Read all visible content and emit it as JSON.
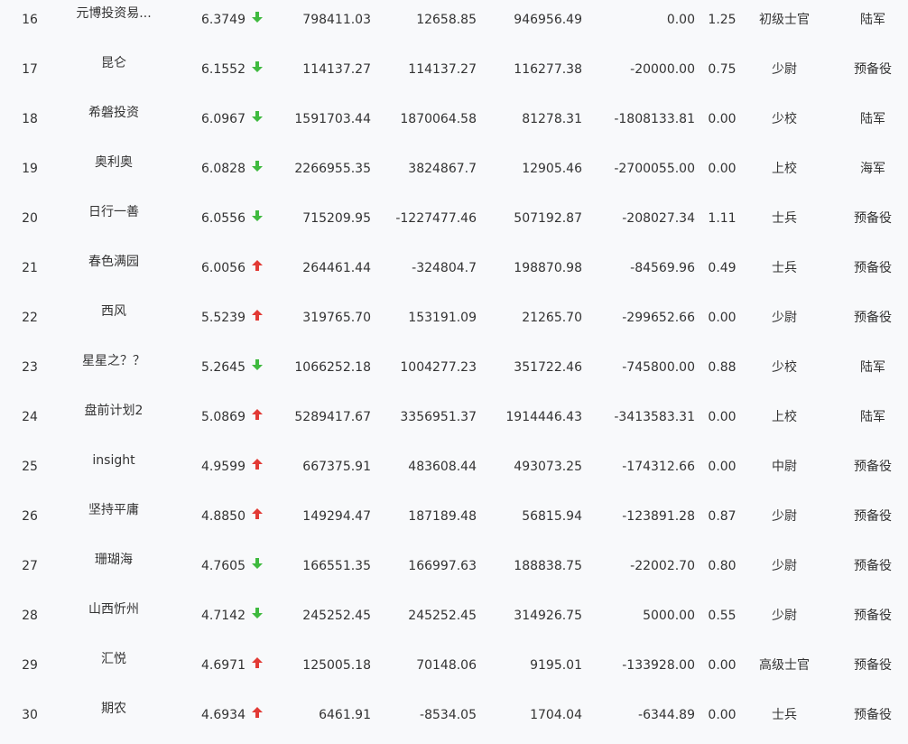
{
  "colors": {
    "up": "#e23a35",
    "down": "#3fba3f",
    "text": "#333333",
    "background": "#f8f9fb"
  },
  "rows": [
    {
      "rank": "16",
      "name": "元博投资易...",
      "nav": "6.3749",
      "trend": "down",
      "v1": "798411.03",
      "v2": "12658.85",
      "v3": "946956.49",
      "v4": "0.00",
      "ratio": "1.25",
      "level": "初级士官",
      "army": "陆军"
    },
    {
      "rank": "17",
      "name": "昆仑",
      "nav": "6.1552",
      "trend": "down",
      "v1": "114137.27",
      "v2": "114137.27",
      "v3": "116277.38",
      "v4": "-20000.00",
      "ratio": "0.75",
      "level": "少尉",
      "army": "预备役"
    },
    {
      "rank": "18",
      "name": "希磐投资",
      "nav": "6.0967",
      "trend": "down",
      "v1": "1591703.44",
      "v2": "1870064.58",
      "v3": "81278.31",
      "v4": "-1808133.81",
      "ratio": "0.00",
      "level": "少校",
      "army": "陆军"
    },
    {
      "rank": "19",
      "name": "奥利奥",
      "nav": "6.0828",
      "trend": "down",
      "v1": "2266955.35",
      "v2": "3824867.7",
      "v3": "12905.46",
      "v4": "-2700055.00",
      "ratio": "0.00",
      "level": "上校",
      "army": "海军"
    },
    {
      "rank": "20",
      "name": "日行一善",
      "nav": "6.0556",
      "trend": "down",
      "v1": "715209.95",
      "v2": "-1227477.46",
      "v3": "507192.87",
      "v4": "-208027.34",
      "ratio": "1.11",
      "level": "士兵",
      "army": "预备役"
    },
    {
      "rank": "21",
      "name": "春色满园",
      "nav": "6.0056",
      "trend": "up",
      "v1": "264461.44",
      "v2": "-324804.7",
      "v3": "198870.98",
      "v4": "-84569.96",
      "ratio": "0.49",
      "level": "士兵",
      "army": "预备役"
    },
    {
      "rank": "22",
      "name": "西风",
      "nav": "5.5239",
      "trend": "up",
      "v1": "319765.70",
      "v2": "153191.09",
      "v3": "21265.70",
      "v4": "-299652.66",
      "ratio": "0.00",
      "level": "少尉",
      "army": "预备役"
    },
    {
      "rank": "23",
      "name": "星星之？？",
      "nav": "5.2645",
      "trend": "down",
      "v1": "1066252.18",
      "v2": "1004277.23",
      "v3": "351722.46",
      "v4": "-745800.00",
      "ratio": "0.88",
      "level": "少校",
      "army": "陆军"
    },
    {
      "rank": "24",
      "name": "盘前计划2",
      "nav": "5.0869",
      "trend": "up",
      "v1": "5289417.67",
      "v2": "3356951.37",
      "v3": "1914446.43",
      "v4": "-3413583.31",
      "ratio": "0.00",
      "level": "上校",
      "army": "陆军"
    },
    {
      "rank": "25",
      "name": "insight",
      "nav": "4.9599",
      "trend": "up",
      "v1": "667375.91",
      "v2": "483608.44",
      "v3": "493073.25",
      "v4": "-174312.66",
      "ratio": "0.00",
      "level": "中尉",
      "army": "预备役"
    },
    {
      "rank": "26",
      "name": "坚持平庸",
      "nav": "4.8850",
      "trend": "up",
      "v1": "149294.47",
      "v2": "187189.48",
      "v3": "56815.94",
      "v4": "-123891.28",
      "ratio": "0.87",
      "level": "少尉",
      "army": "预备役"
    },
    {
      "rank": "27",
      "name": "珊瑚海",
      "nav": "4.7605",
      "trend": "down",
      "v1": "166551.35",
      "v2": "166997.63",
      "v3": "188838.75",
      "v4": "-22002.70",
      "ratio": "0.80",
      "level": "少尉",
      "army": "预备役"
    },
    {
      "rank": "28",
      "name": "山西忻州",
      "nav": "4.7142",
      "trend": "down",
      "v1": "245252.45",
      "v2": "245252.45",
      "v3": "314926.75",
      "v4": "5000.00",
      "ratio": "0.55",
      "level": "少尉",
      "army": "预备役"
    },
    {
      "rank": "29",
      "name": "汇悦",
      "nav": "4.6971",
      "trend": "up",
      "v1": "125005.18",
      "v2": "70148.06",
      "v3": "9195.01",
      "v4": "-133928.00",
      "ratio": "0.00",
      "level": "高级士官",
      "army": "预备役"
    },
    {
      "rank": "30",
      "name": "期农",
      "nav": "4.6934",
      "trend": "up",
      "v1": "6461.91",
      "v2": "-8534.05",
      "v3": "1704.04",
      "v4": "-6344.89",
      "ratio": "0.00",
      "level": "士兵",
      "army": "预备役"
    }
  ]
}
